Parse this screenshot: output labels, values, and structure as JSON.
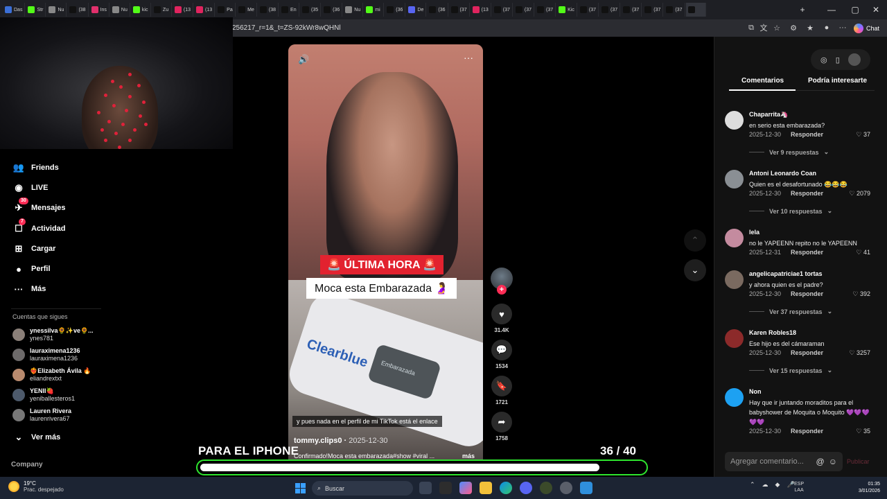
{
  "browser": {
    "tabs": [
      {
        "label": "Das",
        "color": "#3b6fd6",
        "active": false
      },
      {
        "label": "Str",
        "color": "#53fc18",
        "active": false
      },
      {
        "label": "Nu",
        "color": "#888888",
        "active": false
      },
      {
        "label": "(38",
        "color": "#111111",
        "active": false
      },
      {
        "label": "Ins",
        "color": "#e1306c",
        "active": false
      },
      {
        "label": "Nu",
        "color": "#888888",
        "active": false
      },
      {
        "label": "kic",
        "color": "#53fc18",
        "active": false
      },
      {
        "label": "Zu",
        "color": "#111111",
        "active": false
      },
      {
        "label": "(13",
        "color": "#e0245e",
        "active": false
      },
      {
        "label": "(13",
        "color": "#e0245e",
        "active": false
      },
      {
        "label": "Pa",
        "color": "#111111",
        "active": false
      },
      {
        "label": "Me",
        "color": "#111111",
        "active": false
      },
      {
        "label": "(38",
        "color": "#111111",
        "active": false
      },
      {
        "label": "En",
        "color": "#111111",
        "active": false
      },
      {
        "label": "(35",
        "color": "#111111",
        "active": false
      },
      {
        "label": "(36",
        "color": "#111111",
        "active": false
      },
      {
        "label": "Nu",
        "color": "#888888",
        "active": false
      },
      {
        "label": "mi",
        "color": "#53fc18",
        "active": false
      },
      {
        "label": "(36",
        "color": "#111111",
        "active": false
      },
      {
        "label": "De",
        "color": "#5865f2",
        "active": false
      },
      {
        "label": "(36",
        "color": "#111111",
        "active": false
      },
      {
        "label": "(37",
        "color": "#111111",
        "active": false
      },
      {
        "label": "(13",
        "color": "#e0245e",
        "active": false
      },
      {
        "label": "(37",
        "color": "#111111",
        "active": false
      },
      {
        "label": "(37",
        "color": "#111111",
        "active": false
      },
      {
        "label": "(37",
        "color": "#111111",
        "active": false
      },
      {
        "label": "Kic",
        "color": "#53fc18",
        "active": false
      },
      {
        "label": "(37",
        "color": "#111111",
        "active": false
      },
      {
        "label": "(37",
        "color": "#111111",
        "active": false
      },
      {
        "label": "(37",
        "color": "#111111",
        "active": false
      },
      {
        "label": "(37",
        "color": "#111111",
        "active": false
      },
      {
        "label": "(37",
        "color": "#111111",
        "active": false
      },
      {
        "label": "",
        "color": "#111111",
        "active": true
      }
    ],
    "url": "256217_r=1&_t=ZS-92kWr8wQHNl",
    "chat_label": "Chat"
  },
  "sidebar": {
    "items": [
      {
        "label": "Friends",
        "icon": "friends-icon",
        "glyph": "👥",
        "badge": ""
      },
      {
        "label": "LIVE",
        "icon": "live-icon",
        "glyph": "◉",
        "badge": ""
      },
      {
        "label": "Mensajes",
        "icon": "messages-icon",
        "glyph": "✈",
        "badge": "30"
      },
      {
        "label": "Actividad",
        "icon": "activity-icon",
        "glyph": "☐",
        "badge": "7"
      },
      {
        "label": "Cargar",
        "icon": "upload-icon",
        "glyph": "⊞",
        "badge": ""
      },
      {
        "label": "Perfil",
        "icon": "profile-icon",
        "glyph": "●",
        "badge": ""
      },
      {
        "label": "Más",
        "icon": "more-icon",
        "glyph": "···",
        "badge": ""
      }
    ],
    "following_title": "Cuentas que sigues",
    "following": [
      {
        "name": "ynessilva🌻✨ve🌻...",
        "username": "ynes781"
      },
      {
        "name": "lauraximena1236",
        "username": "lauraximena1236"
      },
      {
        "name": "❤️‍🔥Elizabeth Ávila 🔥",
        "username": "eliandrextxt"
      },
      {
        "name": "YENII🍓",
        "username": "yeniballesteros1"
      },
      {
        "name": "Lauren Rivera",
        "username": "laurenrivera67"
      }
    ],
    "see_more": "Ver más",
    "company": "Company"
  },
  "video": {
    "headline": "🚨 ÚLTIMA HORA 🚨",
    "subheadline": "Moca esta Embarazada 🤰",
    "test_brand": "Clearblue",
    "test_label": "Embarazada",
    "caption_overlay": "y pues nada en el perfil de mi TikTok está el enlace",
    "author": "tommy.clips0",
    "date": "2025-12-30",
    "description": "Confirmado!Moca esta embarazada#show #viral ...",
    "more": "más"
  },
  "actions": {
    "likes": "31.4K",
    "comments": "1534",
    "saves": "1721",
    "shares": "1758"
  },
  "overlay": {
    "left_text": "PARA EL IPHONE",
    "counter": "36   / 40",
    "progress": 0.9
  },
  "panel": {
    "tab_comments": "Comentarios",
    "tab_related": "Podría interesarte",
    "reply_label": "Responder",
    "comments": [
      {
        "user": "Chaparrita🦄",
        "text": "en serio esta embarazada?",
        "date": "2025-12-30",
        "likes": "37",
        "more": "Ver 9 respuestas",
        "avatar": "#dddddd"
      },
      {
        "user": "Antoni Leonardo Coan",
        "text": "Quien es el desafortunado 😂😂😂",
        "date": "2025-12-30",
        "likes": "2079",
        "more": "Ver 10 respuestas",
        "avatar": "#8a8f94"
      },
      {
        "user": "lela",
        "text": "no le YAPEENN repito no le YAPEENN",
        "date": "2025-12-31",
        "likes": "41",
        "more": "",
        "avatar": "#c48b9f"
      },
      {
        "user": "angelicapatriciae1 tortas",
        "text": "y ahora quien es el padre?",
        "date": "2025-12-30",
        "likes": "392",
        "more": "Ver 37 respuestas",
        "avatar": "#7a6a60"
      },
      {
        "user": "Karen Robles18",
        "text": "Ese hijo es del cámaraman",
        "date": "2025-12-30",
        "likes": "3257",
        "more": "Ver 15 respuestas",
        "avatar": "#8c2a2a"
      },
      {
        "user": "Non",
        "text": "Hay que ir juntando moraditos para el babyshower de Moquita o Moquito 💜💜💜💜💜",
        "date": "2025-12-30",
        "likes": "35",
        "more": "",
        "avatar": "#1da1f2"
      }
    ],
    "add_placeholder": "Agregar comentario...",
    "publish": "Publicar"
  },
  "taskbar": {
    "temp": "19°C",
    "weather": "Prac. despejado",
    "search": "Buscar",
    "lang_1": "ESP",
    "lang_2": "LAA",
    "time": "01:35",
    "date": "3/01/2026"
  }
}
